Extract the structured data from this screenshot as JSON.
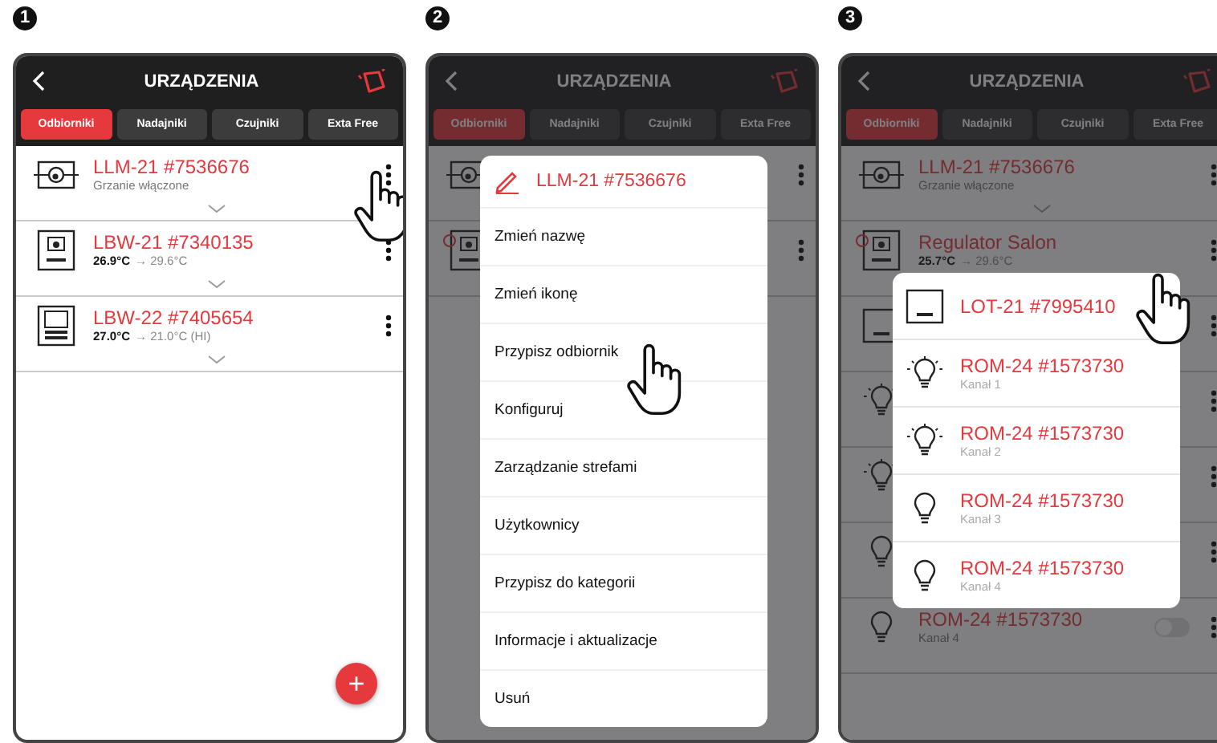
{
  "panels": [
    {
      "step": "1",
      "title": "URZĄDZENIA",
      "dimmed": false,
      "tabs": [
        {
          "label": "Odbiorniki",
          "selected": true
        },
        {
          "label": "Nadajniki",
          "selected": false
        },
        {
          "label": "Czujniki",
          "selected": false
        },
        {
          "label": "Exta Free",
          "selected": false
        }
      ],
      "devices": [
        {
          "kind": "pump",
          "name": "LLM-21 #7536676",
          "status": "Grzanie włączone",
          "expandable": true,
          "marked": false,
          "pointed": true
        },
        {
          "kind": "thermostat",
          "name": "LBW-21 #7340135",
          "current": "26.9°C",
          "target": "→ 29.6°C",
          "expandable": true,
          "marked": false,
          "pointed": false
        },
        {
          "kind": "display",
          "name": "LBW-22 #7405654",
          "current": "27.0°C",
          "target": "→ 21.0°C (HI)",
          "expandable": true,
          "marked": false,
          "pointed": false
        }
      ],
      "add_button": "+"
    },
    {
      "step": "2",
      "title": "URZĄDZENIA",
      "dimmed": true,
      "tabs": [
        {
          "label": "Odbiorniki",
          "selected": true
        },
        {
          "label": "Nadajniki",
          "selected": false
        },
        {
          "label": "Czujniki",
          "selected": false
        },
        {
          "label": "Exta Free",
          "selected": false
        }
      ],
      "devices": [
        {
          "kind": "pump",
          "expandable": false,
          "marked": false,
          "pointed": false
        },
        {
          "kind": "thermostat",
          "expandable": false,
          "marked": true,
          "pointed": false
        }
      ],
      "menu": {
        "header": "LLM-21 #7536676",
        "items": [
          {
            "label": "Zmień nazwę",
            "pointed": false
          },
          {
            "label": "Zmień ikonę",
            "pointed": false
          },
          {
            "label": "Przypisz odbiornik",
            "pointed": true
          },
          {
            "label": "Konfiguruj",
            "pointed": false
          },
          {
            "label": "Zarządzanie strefami",
            "pointed": false
          },
          {
            "label": "Użytkownicy",
            "pointed": false
          },
          {
            "label": "Przypisz do kategorii",
            "pointed": false
          },
          {
            "label": "Informacje i aktualizacje",
            "pointed": false
          },
          {
            "label": "Usuń",
            "pointed": false
          }
        ]
      }
    },
    {
      "step": "3",
      "title": "URZĄDZENIA",
      "dimmed": true,
      "tabs": [
        {
          "label": "Odbiorniki",
          "selected": true
        },
        {
          "label": "Nadajniki",
          "selected": false
        },
        {
          "label": "Czujniki",
          "selected": false
        },
        {
          "label": "Exta Free",
          "selected": false
        }
      ],
      "devices": [
        {
          "kind": "pump",
          "name": "LLM-21 #7536676",
          "status": "Grzanie włączone",
          "expandable": true,
          "marked": false,
          "pointed": false
        },
        {
          "kind": "thermostat",
          "name": "Regulator Salon",
          "current": "25.7°C",
          "target": "→ 29.6°C",
          "expandable": false,
          "marked": true,
          "pointed": false
        },
        {
          "kind": "module",
          "expandable": false,
          "marked": false,
          "pointed": false
        },
        {
          "kind": "bulb-lit",
          "expandable": false,
          "marked": false,
          "pointed": false
        },
        {
          "kind": "bulb-lit",
          "expandable": false,
          "marked": false,
          "pointed": false
        },
        {
          "kind": "bulb",
          "expandable": false,
          "marked": false,
          "pointed": false
        },
        {
          "kind": "bulb",
          "name": "ROM-24 #1573730",
          "status": "Kanał 4",
          "switch": {
            "on": false
          },
          "expandable": false,
          "marked": false,
          "pointed": false
        }
      ],
      "picker": [
        {
          "kind": "module",
          "name": "LOT-21 #7995410",
          "pointed": true
        },
        {
          "kind": "bulb-lit",
          "name": "ROM-24 #1573730",
          "status": "Kanał 1",
          "pointed": false
        },
        {
          "kind": "bulb-lit",
          "name": "ROM-24 #1573730",
          "status": "Kanał 2",
          "pointed": false
        },
        {
          "kind": "bulb",
          "name": "ROM-24 #1573730",
          "status": "Kanał 3",
          "pointed": false
        },
        {
          "kind": "bulb",
          "name": "ROM-24 #1573730",
          "status": "Kanał 4",
          "pointed": false
        }
      ]
    }
  ]
}
